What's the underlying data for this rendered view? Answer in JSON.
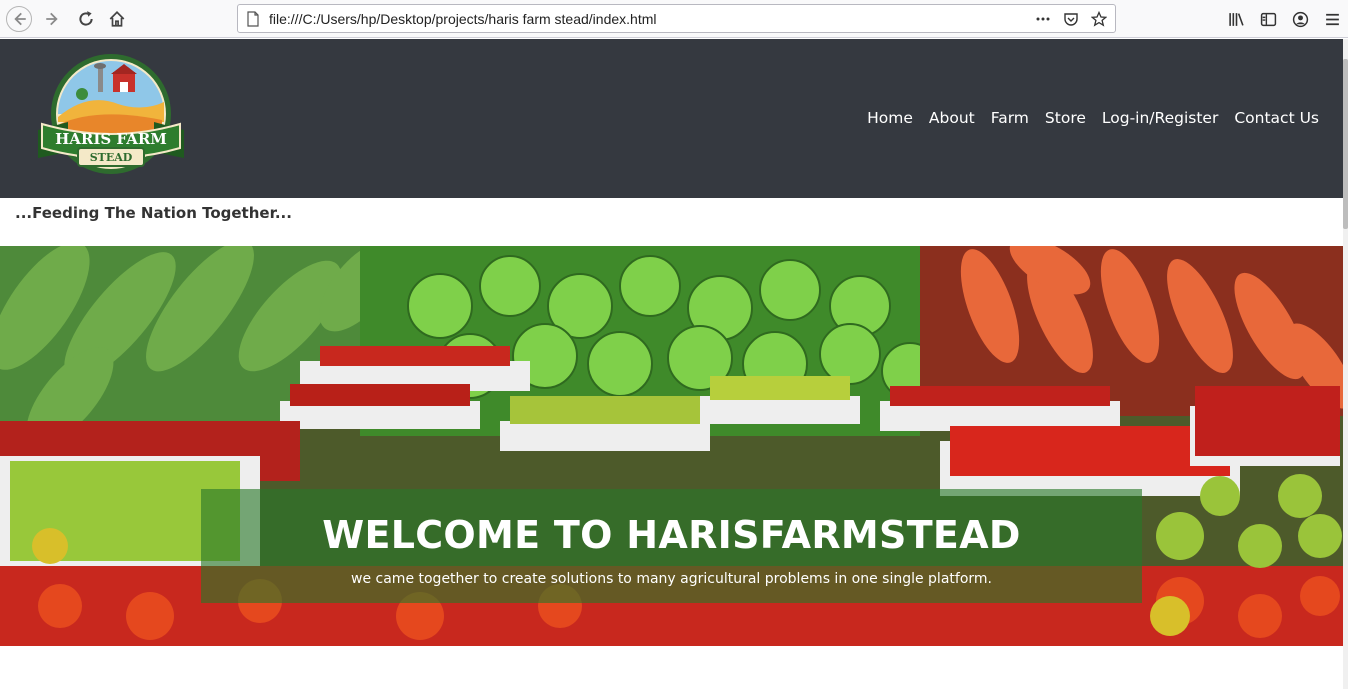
{
  "browser": {
    "url": "file:///C:/Users/hp/Desktop/projects/haris farm stead/index.html",
    "icons": [
      "back-icon",
      "forward-icon",
      "reload-icon",
      "home-icon",
      "page-icon",
      "more-icon",
      "pocket-icon",
      "star-icon",
      "library-icon",
      "sidebar-icon",
      "account-icon",
      "menu-icon"
    ]
  },
  "logo": {
    "line1": "HARIS FARM",
    "line2": "STEAD"
  },
  "nav": {
    "items": [
      {
        "label": "Home"
      },
      {
        "label": "About"
      },
      {
        "label": "Farm"
      },
      {
        "label": "Store"
      },
      {
        "label": "Log-in/Register"
      },
      {
        "label": "Contact Us"
      }
    ]
  },
  "tagline": "...Feeding The Nation Together...",
  "hero": {
    "title": "WELCOME TO HARISFARMSTEAD",
    "subtitle": "we came together to create solutions to many agricultural problems in one single platform."
  },
  "colors": {
    "header_bg": "#353940",
    "overlay": "#287828",
    "text": "#ffffff"
  }
}
